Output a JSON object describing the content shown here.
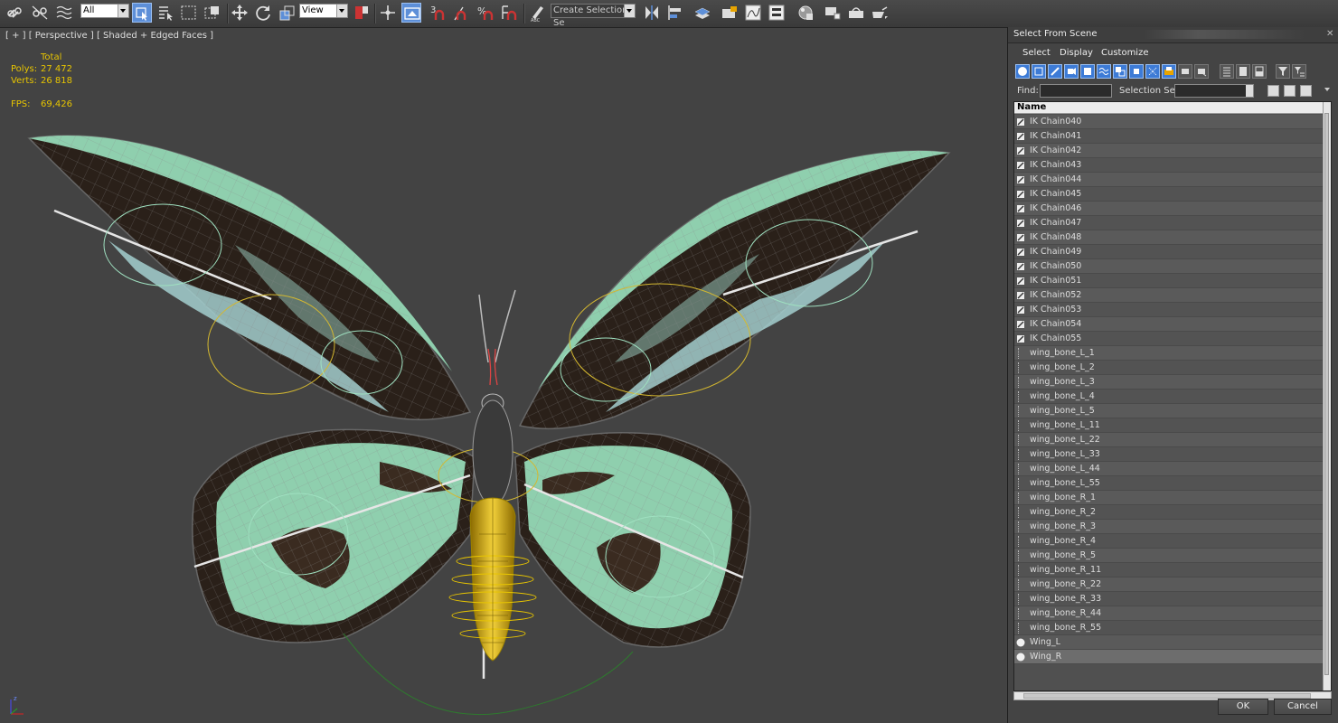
{
  "toolbar": {
    "selection_filter": "All",
    "reference_coord": "View",
    "named_selection": "Create Selection Se"
  },
  "viewport": {
    "label": "[ + ] [ Perspective ] [ Shaded + Edged Faces ]",
    "stats": {
      "total_label": "Total",
      "polys_label": "Polys:",
      "polys_value": "27 472",
      "verts_label": "Verts:",
      "verts_value": "26 818",
      "fps_label": "FPS:",
      "fps_value": "69,426"
    },
    "axis": {
      "x": "x",
      "y": "y",
      "z": "z"
    }
  },
  "dialog": {
    "title": "Select From Scene",
    "menu": [
      "Select",
      "Display",
      "Customize"
    ],
    "find_label": "Find:",
    "find_value": "",
    "selection_set_label": "Selection Set:",
    "selection_set_value": "",
    "column_header": "Name",
    "ok_label": "OK",
    "cancel_label": "Cancel",
    "items": [
      {
        "name": "IK Chain040",
        "type": "ik"
      },
      {
        "name": "IK Chain041",
        "type": "ik"
      },
      {
        "name": "IK Chain042",
        "type": "ik"
      },
      {
        "name": "IK Chain043",
        "type": "ik"
      },
      {
        "name": "IK Chain044",
        "type": "ik"
      },
      {
        "name": "IK Chain045",
        "type": "ik"
      },
      {
        "name": "IK Chain046",
        "type": "ik"
      },
      {
        "name": "IK Chain047",
        "type": "ik"
      },
      {
        "name": "IK Chain048",
        "type": "ik"
      },
      {
        "name": "IK Chain049",
        "type": "ik"
      },
      {
        "name": "IK Chain050",
        "type": "ik"
      },
      {
        "name": "IK Chain051",
        "type": "ik"
      },
      {
        "name": "IK Chain052",
        "type": "ik"
      },
      {
        "name": "IK Chain053",
        "type": "ik"
      },
      {
        "name": "IK Chain054",
        "type": "ik"
      },
      {
        "name": "IK Chain055",
        "type": "ik"
      },
      {
        "name": "wing_bone_L_1",
        "type": "bone"
      },
      {
        "name": "wing_bone_L_2",
        "type": "bone"
      },
      {
        "name": "wing_bone_L_3",
        "type": "bone"
      },
      {
        "name": "wing_bone_L_4",
        "type": "bone"
      },
      {
        "name": "wing_bone_L_5",
        "type": "bone"
      },
      {
        "name": "wing_bone_L_11",
        "type": "bone"
      },
      {
        "name": "wing_bone_L_22",
        "type": "bone"
      },
      {
        "name": "wing_bone_L_33",
        "type": "bone"
      },
      {
        "name": "wing_bone_L_44",
        "type": "bone"
      },
      {
        "name": "wing_bone_L_55",
        "type": "bone"
      },
      {
        "name": "wing_bone_R_1",
        "type": "bone"
      },
      {
        "name": "wing_bone_R_2",
        "type": "bone"
      },
      {
        "name": "wing_bone_R_3",
        "type": "bone"
      },
      {
        "name": "wing_bone_R_4",
        "type": "bone"
      },
      {
        "name": "wing_bone_R_5",
        "type": "bone"
      },
      {
        "name": "wing_bone_R_11",
        "type": "bone"
      },
      {
        "name": "wing_bone_R_22",
        "type": "bone"
      },
      {
        "name": "wing_bone_R_33",
        "type": "bone"
      },
      {
        "name": "wing_bone_R_44",
        "type": "bone"
      },
      {
        "name": "wing_bone_R_55",
        "type": "bone"
      },
      {
        "name": "Wing_L",
        "type": "mesh"
      },
      {
        "name": "Wing_R",
        "type": "mesh",
        "selected": true
      }
    ]
  },
  "colors": {
    "accent": "#3d7bd6",
    "stats_text": "#e8c500",
    "viewport_bg": "#434343",
    "wing_green": "#8fcfae",
    "wing_dark": "#2a2019",
    "body_yellow": "#e8c52a"
  }
}
